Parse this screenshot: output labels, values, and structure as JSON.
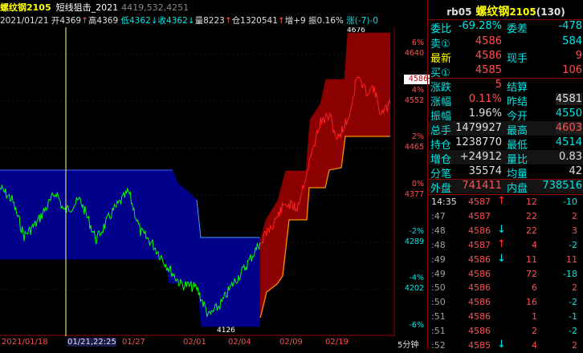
{
  "header": {
    "symbol": "螺纹钢2105",
    "strategy": "短线狙击_2021",
    "extra": "4419,532,4251",
    "date": "2021/01/21",
    "open": "开4369",
    "high": "高4369",
    "low": "低4362",
    "close": "收4362",
    "volume": "量8223",
    "oi": "仓1320541",
    "oi_change": "增+9",
    "amplitude": "振0.16%",
    "change": "涨(-7)-0"
  },
  "chart_data": {
    "type": "area",
    "title": "",
    "xlabel": "",
    "ylabel": "",
    "y_ticks": [
      {
        "price": "4640",
        "pct": "6%"
      },
      {
        "price": "4552",
        "pct": "4%"
      },
      {
        "price": "4465",
        "pct": "2%"
      },
      {
        "price": "4377",
        "pct": "0%"
      },
      {
        "price": "4289",
        "pct": "-2%"
      },
      {
        "price": "4202",
        "pct": "-4%"
      },
      {
        "price": "",
        "pct": "-6%"
      }
    ],
    "top_label": "4676",
    "bottom_label": "4126",
    "current_price": "4586",
    "ylim": [
      4114,
      4690
    ],
    "x_labels": [
      "2021/01/18",
      "01/21,22:25",
      "01/27",
      "02/01",
      "02/04",
      "02/09",
      "02/19"
    ],
    "period": "5分钟",
    "colors": {
      "bear_band": "#00008b",
      "bull_band": "#8b0000",
      "bear_price": "#00ff00",
      "bull_price": "#ff2020",
      "bull_band_top": "#000000",
      "bull_band_bottom": "#ff8c00",
      "bear_band_bottom": "#3ea0ff"
    }
  },
  "panel": {
    "code": "rb05",
    "name": "螺纹钢",
    "contract": "2105",
    "count": "(130)",
    "rows": [
      {
        "l1": "委比",
        "v1": "-69.28%",
        "l2": "委差",
        "v2": "-478"
      },
      {
        "l1": "卖①",
        "v1": "4586",
        "l2": "",
        "v2": "584"
      },
      {
        "l1": "最新",
        "v1": "4586",
        "l2": "现手",
        "v2": "9"
      },
      {
        "l1": "买①",
        "v1": "4585",
        "l2": "",
        "v2": "106"
      },
      {
        "l1": "涨跌",
        "v1": "5",
        "l2": "结算",
        "v2": ""
      },
      {
        "l1": "涨幅",
        "v1": "0.11%",
        "l2": "昨结",
        "v2": "4581"
      },
      {
        "l1": "振幅",
        "v1": "1.96%",
        "l2": "今开",
        "v2": "4550"
      },
      {
        "l1": "总手",
        "v1": "1479927",
        "l2": "最高",
        "v2": "4603"
      },
      {
        "l1": "持仓",
        "v1": "1238770",
        "l2": "最低",
        "v2": "4514"
      },
      {
        "l1": "增仓",
        "v1": "+24912",
        "l2": "量比",
        "v2": "0.83"
      },
      {
        "l1": "分笔",
        "v1": "35574",
        "l2": "均量",
        "v2": "42"
      },
      {
        "l1": "外盘",
        "v1": "741411",
        "l2": "内盘",
        "v2": "738516"
      }
    ],
    "ticks": [
      {
        "time": "14:35",
        "price": "4587",
        "dir": "up",
        "vol": "12",
        "oi": "-10"
      },
      {
        "time": ":47",
        "price": "4587",
        "dir": "",
        "vol": "22",
        "oi": "2"
      },
      {
        "time": ":48",
        "price": "4586",
        "dir": "dn",
        "vol": "22",
        "oi": "3"
      },
      {
        "time": ":48",
        "price": "4587",
        "dir": "up",
        "vol": "4",
        "oi": "-2"
      },
      {
        "time": ":49",
        "price": "4586",
        "dir": "dn",
        "vol": "11",
        "oi": "11"
      },
      {
        "time": ":49",
        "price": "4586",
        "dir": "",
        "vol": "72",
        "oi": "-18"
      },
      {
        "time": ":50",
        "price": "4586",
        "dir": "",
        "vol": "6",
        "oi": "2"
      },
      {
        "time": ":50",
        "price": "4586",
        "dir": "",
        "vol": "16",
        "oi": "-2"
      },
      {
        "time": ":51",
        "price": "4586",
        "dir": "",
        "vol": "1",
        "oi": "-1"
      },
      {
        "time": ":51",
        "price": "4586",
        "dir": "",
        "vol": "2",
        "oi": "-2"
      },
      {
        "time": ":52",
        "price": "4585",
        "dir": "dn",
        "vol": "4",
        "oi": "2"
      }
    ]
  }
}
